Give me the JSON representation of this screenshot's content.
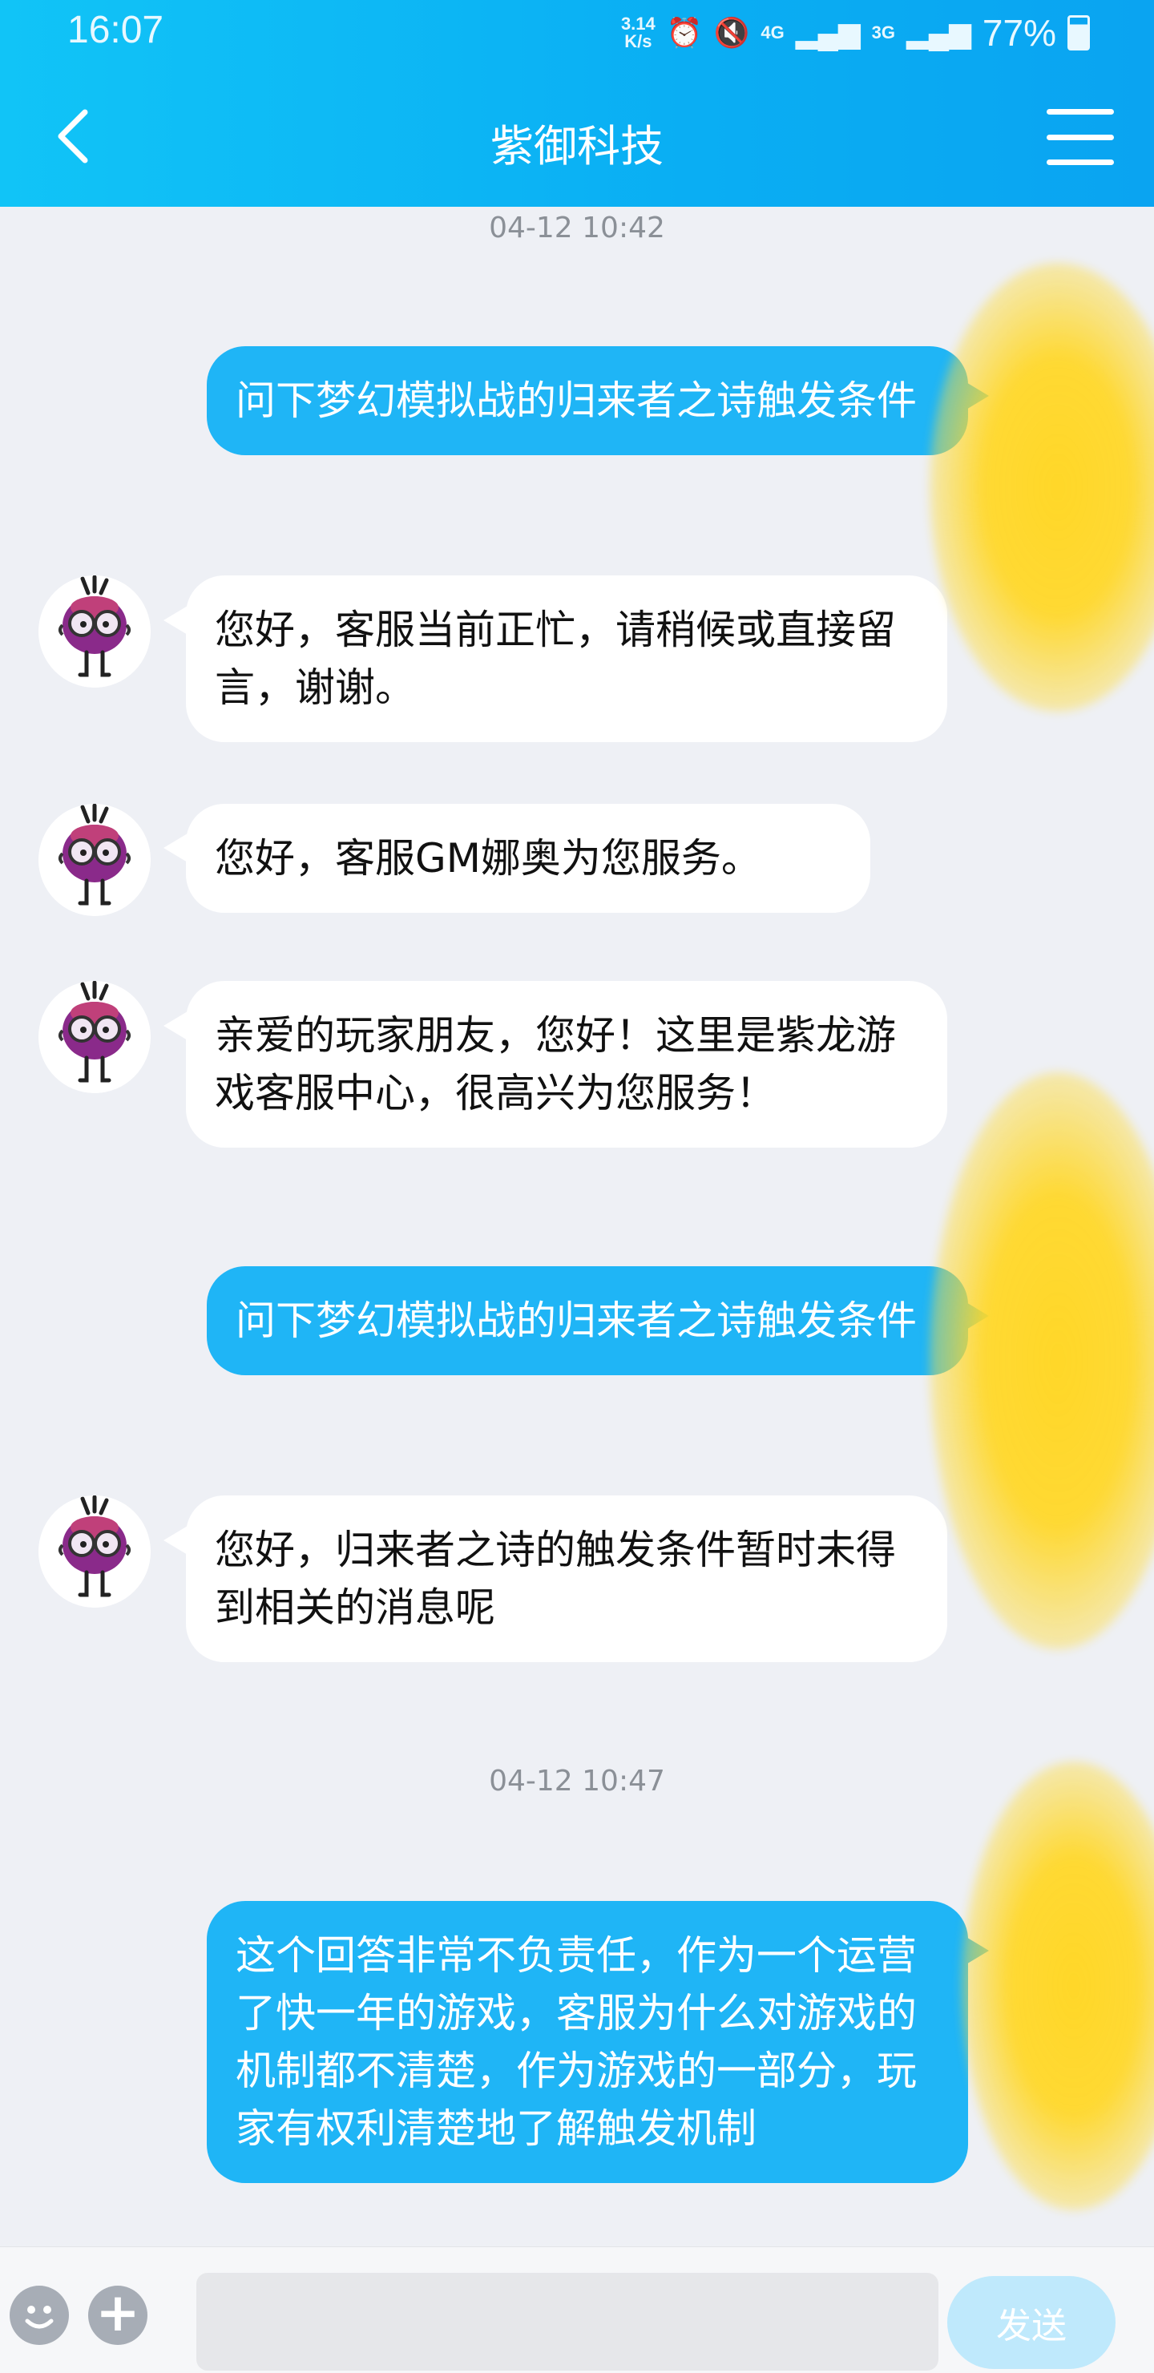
{
  "status_bar": {
    "time": "16:07",
    "net_speed_value": "3.14",
    "net_speed_unit": "K/s",
    "network_4g": "4G",
    "network_3g": "3G",
    "battery_percent": "77%",
    "icons": [
      "alarm-icon",
      "mute-icon",
      "signal-icon",
      "battery-icon"
    ]
  },
  "header": {
    "title": "紫御科技",
    "back_icon": "chevron-left-icon",
    "menu_icon": "hamburger-menu-icon"
  },
  "colors": {
    "header": "#0aaef3",
    "my_bubble": "#1fb5f6",
    "cs_bubble": "#ffffff",
    "background": "#eef0f5",
    "send_button": "#bfe9fc",
    "redaction": "#ffd728"
  },
  "messages": {
    "ts1": "04-12 10:42",
    "m1": "问下梦幻模拟战的归来者之诗触发条件",
    "m2": "您好，客服当前正忙，请稍候或直接留言，谢谢。",
    "m3": "您好，客服GM娜奥为您服务。",
    "m4": "亲爱的玩家朋友，您好！这里是紫龙游戏客服中心，很高兴为您服务！",
    "m5": "问下梦幻模拟战的归来者之诗触发条件",
    "m6": "您好，归来者之诗的触发条件暂时未得到相关的消息呢",
    "ts2": "04-12 10:47",
    "m7": "这个回答非常不负责任，作为一个运营了快一年的游戏，客服为什么对游戏的机制都不清楚，作为游戏的一部分，玩家有权利清楚地了解触发机制"
  },
  "input_bar": {
    "emoji_icon": "smiley-icon",
    "plus_icon": "plus-icon",
    "input_value": "",
    "send_label": "发送"
  }
}
